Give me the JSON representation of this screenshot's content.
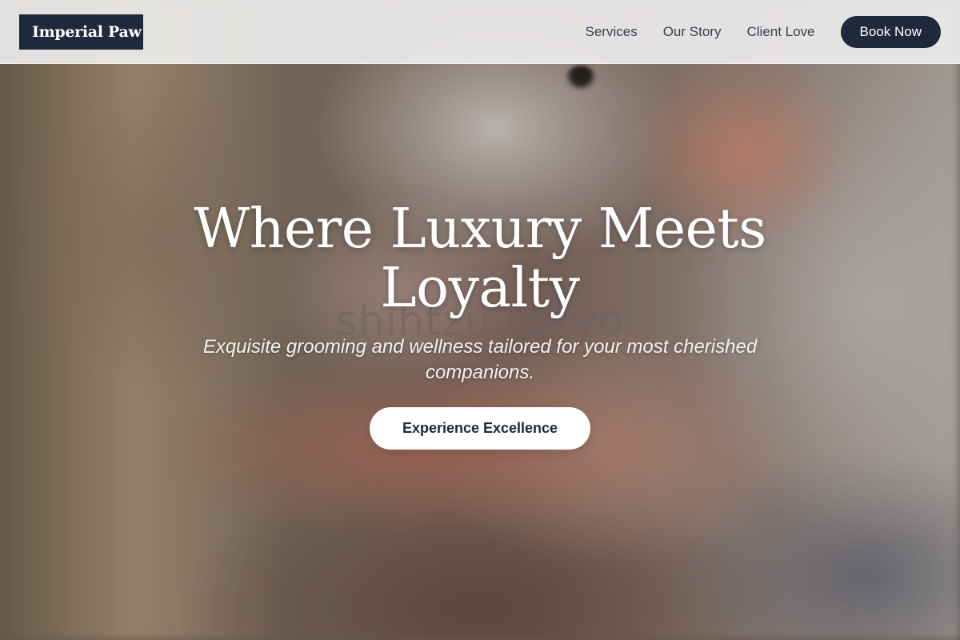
{
  "header": {
    "logo_text": "Imperial Paw",
    "nav": [
      {
        "label": "Services"
      },
      {
        "label": "Our Story"
      },
      {
        "label": "Client Love"
      }
    ],
    "book_button_label": "Book Now"
  },
  "hero": {
    "title": "Where Luxury Meets Loyalty",
    "subtitle": "Exquisite grooming and wellness tailored for your most cherished companions.",
    "cta_label": "Experience Excellence",
    "watermark": "shihtzu.tokyo"
  },
  "colors": {
    "brand_navy": "#1e293b",
    "header_background": "#ecebea",
    "cta_background": "#ffffff"
  }
}
